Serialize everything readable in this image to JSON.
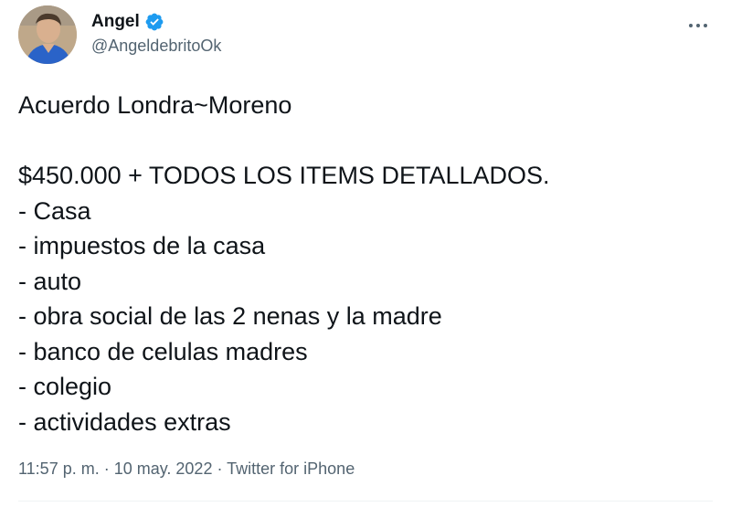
{
  "user": {
    "display_name": "Angel",
    "handle": "@AngeldebritoOk",
    "verified": true
  },
  "tweet": {
    "lines": [
      "Acuerdo Londra~Moreno",
      "",
      "$450.000 + TODOS LOS ITEMS DETALLADOS.",
      "- Casa",
      "- impuestos de la casa",
      "- auto",
      "- obra social de las 2 nenas y la madre",
      "- banco de celulas madres",
      "- colegio",
      "- actividades extras"
    ],
    "time": "11:57 p. m.",
    "separator": " · ",
    "date": "10 may. 2022",
    "source": "Twitter for iPhone"
  },
  "icons": {
    "verified": "verified-badge-icon",
    "more": "more-dots-icon"
  },
  "colors": {
    "verified_blue": "#1d9bf0",
    "text": "#0f1419",
    "muted": "#536471"
  }
}
